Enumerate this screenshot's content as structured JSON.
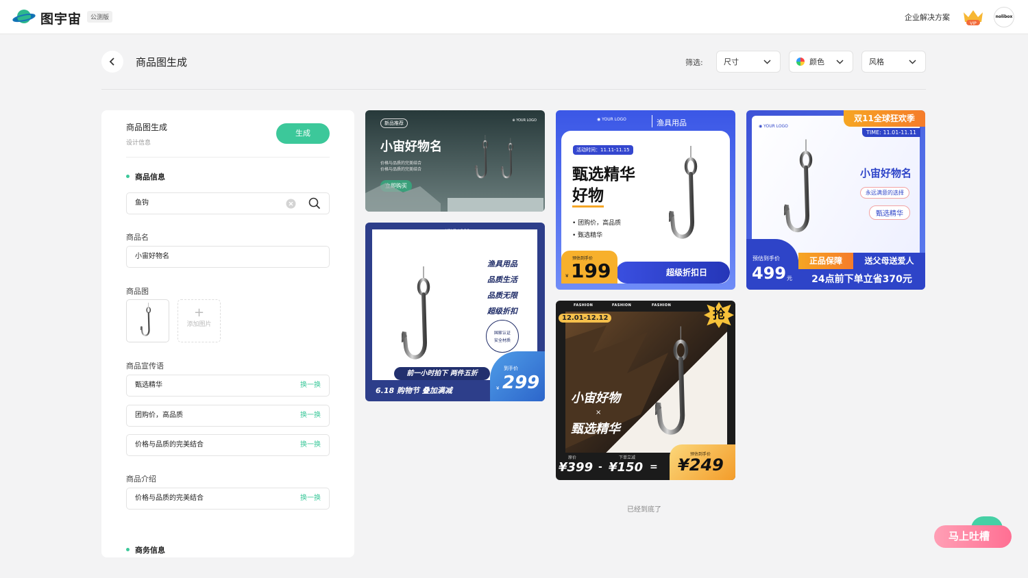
{
  "header": {
    "app_name": "图宇宙",
    "badge": "公测版",
    "enterprise": "企业解决方案",
    "vip": "VIP",
    "avatar": "nolibox"
  },
  "page": {
    "title": "商品图生成",
    "filter_label": "筛选:",
    "filters": [
      {
        "label": "尺寸"
      },
      {
        "label": "颜色"
      },
      {
        "label": "风格"
      }
    ]
  },
  "panel": {
    "title": "商品图生成",
    "subtitle": "设计信息",
    "generate": "生成",
    "section_product": "商品信息",
    "search_value": "鱼钩",
    "name_label": "商品名",
    "name_value": "小宙好物名",
    "image_label": "商品图",
    "add_image": "添加图片",
    "slogan_label": "商品宣传语",
    "slogans": [
      {
        "text": "甄选精华",
        "action": "换一换"
      },
      {
        "text": "团购价，高品质",
        "action": "换一换"
      },
      {
        "text": "价格与品质的完美结合",
        "action": "换一换"
      }
    ],
    "intro_label": "商品介绍",
    "intro": {
      "text": "价格与品质的完美结合",
      "action": "换一换"
    },
    "section_business": "商务信息"
  },
  "cards": {
    "c1": {
      "tag": "新品推荐",
      "logo": "YOUR LOGO",
      "title": "小宙好物名",
      "desc1": "价格与品质的完美结合",
      "desc2": "价格与品质的完美结合",
      "cta": "立即购买"
    },
    "c2": {
      "logo": "YOUR LOGO",
      "lines": [
        "渔具用品",
        "品质生活",
        "品质无限",
        "超级折扣"
      ],
      "seal1": "国家认证",
      "seal2": "安全材质",
      "banner": "前一小时拍下 两件五折",
      "bottom": "6.18 购物节 叠加满减",
      "price_label": "到手价",
      "currency": "¥",
      "price": "299"
    },
    "c3": {
      "logo": "YOUR LOGO",
      "category": "渔具用品",
      "time": "活动时间：11.11-11.15",
      "title1": "甄选精华",
      "title2": "好物",
      "bullet1": "团购价，高品质",
      "bullet2": "甄选精华",
      "price_label": "预估到手价",
      "currency": "¥",
      "price": "199",
      "promo": "超级折扣日"
    },
    "c4": {
      "tag": "FASHION",
      "date": "12.01-12.12",
      "grab": "抢",
      "title1": "小宙好物",
      "x": "×",
      "title2": "甄选精华",
      "orig_label": "原价",
      "orig": "¥399",
      "minus": "-",
      "disc_label": "下单立减",
      "disc": "¥150",
      "eq": "=",
      "final_label": "预估到手价",
      "final": "¥249"
    },
    "c5": {
      "ribbon": "双11全球狂欢季",
      "time": "TIME: 11.01-11.11",
      "logo": "YOUR LOGO",
      "title": "小宙好物名",
      "tag1": "永远满意的选择",
      "tag2": "甄选精华",
      "price_label": "预估到手价",
      "price": "499",
      "unit": "元",
      "badge": "正品保障",
      "gift": "送父母送爱人",
      "footer": "24点前下单立省370元"
    }
  },
  "end_text": "已经到底了",
  "feedback": "马上吐槽"
}
